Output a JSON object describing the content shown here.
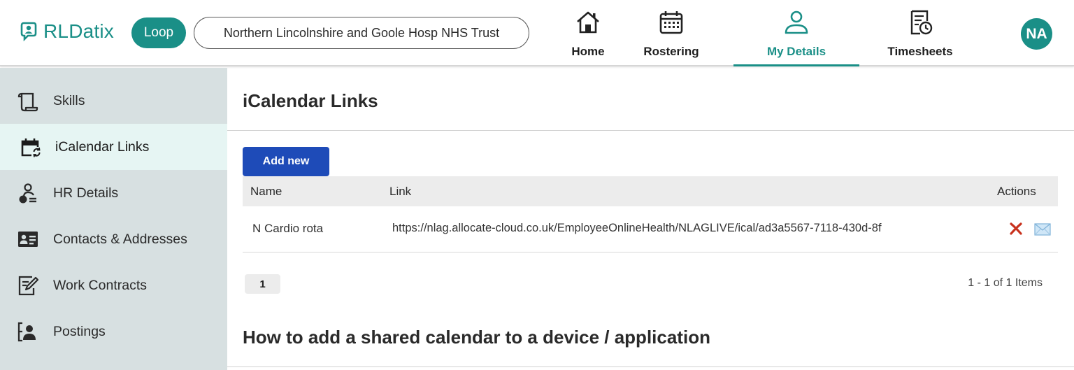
{
  "header": {
    "brand": "RLDatix",
    "app_pill": "Loop",
    "organisation": "Northern Lincolnshire and Goole Hosp NHS Trust",
    "nav": [
      {
        "label": "Home",
        "icon": "home-icon"
      },
      {
        "label": "Rostering",
        "icon": "calendar-grid-icon"
      },
      {
        "label": "My Details",
        "icon": "user-icon",
        "active": true
      },
      {
        "label": "Timesheets",
        "icon": "timesheet-clock-icon"
      }
    ],
    "avatar_initials": "NA"
  },
  "sidebar": {
    "items": [
      {
        "label": "Skills",
        "icon": "scroll-icon"
      },
      {
        "label": "iCalendar Links",
        "icon": "calendar-sync-icon",
        "active": true
      },
      {
        "label": "HR Details",
        "icon": "person-people-icon"
      },
      {
        "label": "Contacts & Addresses",
        "icon": "contact-card-icon"
      },
      {
        "label": "Work Contracts",
        "icon": "contract-edit-icon"
      },
      {
        "label": "Postings",
        "icon": "posting-person-icon"
      }
    ]
  },
  "main": {
    "title": "iCalendar Links",
    "add_button": "Add new",
    "table": {
      "columns": [
        "Name",
        "Link",
        "Actions"
      ],
      "rows": [
        {
          "name": "N Cardio rota",
          "link": "https://nlag.allocate-cloud.co.uk/EmployeeOnlineHealth/NLAGLIVE/ical/ad3a5567-7118-430d-8f",
          "actions": [
            "delete-icon",
            "email-icon"
          ]
        }
      ]
    },
    "pager": {
      "current_page": "1",
      "info": "1 - 1 of 1 Items"
    },
    "section_heading": "How to add a shared calendar to a device / application"
  },
  "colors": {
    "brand_teal": "#1a8f87",
    "primary_button": "#1e4bb8",
    "sidebar_bg": "#d7e0e1",
    "sidebar_active_bg": "#e6f5f3",
    "delete_red": "#c8321e"
  }
}
